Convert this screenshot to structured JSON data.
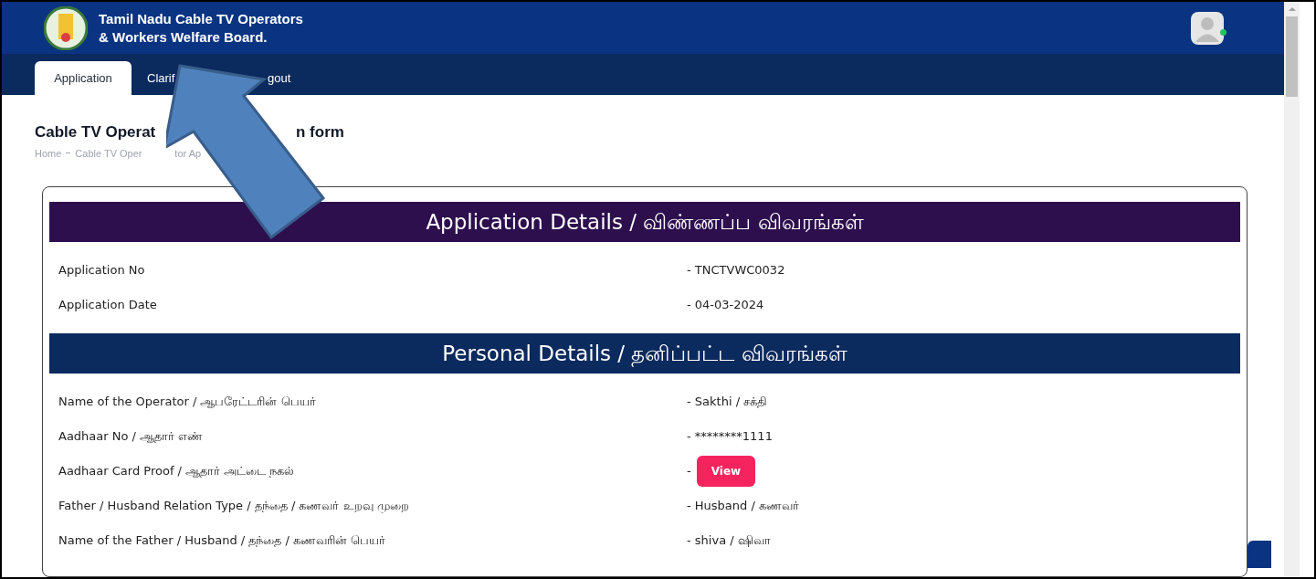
{
  "header": {
    "title_line_1": "Tamil Nadu Cable TV Operators",
    "title_line_2": "& Workers Welfare Board.",
    "user_online": true
  },
  "tabs": [
    {
      "label": "Application",
      "selected": true
    },
    {
      "label": "Clarif",
      "selected": false
    },
    {
      "label": "gout",
      "selected": false
    }
  ],
  "page": {
    "title_parts": [
      "Cable TV Operat",
      "n form"
    ],
    "breadcrumb": [
      "Home",
      "Cable TV Oper",
      "tor Ap"
    ]
  },
  "sections": [
    {
      "title": "Application Details / விண்ணப்ப விவரங்கள்",
      "kind": "purple",
      "rows": [
        {
          "label": "Application No",
          "value": "- TNCTVWC0032"
        },
        {
          "label": "Application Date",
          "value": "- 04-03-2024"
        }
      ]
    },
    {
      "title": "Personal Details / தனிப்பட்ட விவரங்கள்",
      "kind": "navy",
      "rows": [
        {
          "label": "Name of the Operator / ஆபரேட்டரின் பெயர்",
          "value": "- Sakthi / சக்தி"
        },
        {
          "label": "Aadhaar No / ஆதார் எண்",
          "value": "- ********1111"
        },
        {
          "label": "Aadhaar Card Proof / ஆதார் அட்டை நகல்",
          "value": "-",
          "button": "View"
        },
        {
          "label": "Father / Husband Relation Type / தந்தை / கணவர் உறவு முறை",
          "value": "- Husband / கணவர்"
        },
        {
          "label": "Name of the Father / Husband / தந்தை / கணவரின் பெயர்",
          "value": "- shiva / ஷிவா"
        }
      ]
    }
  ]
}
